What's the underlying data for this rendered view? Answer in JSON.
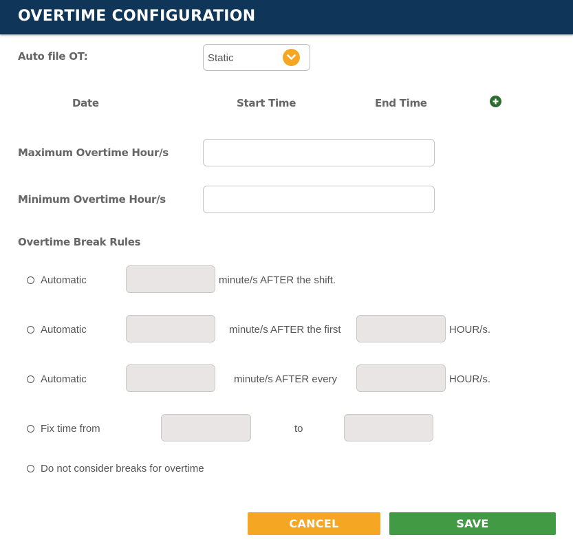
{
  "header": {
    "title": "OVERTIME CONFIGURATION"
  },
  "auto_file": {
    "label": "Auto file OT:",
    "selected": "Static"
  },
  "columns": {
    "date": "Date",
    "start": "Start Time",
    "end": "End Time"
  },
  "max_ot": {
    "label": "Maximum Overtime Hour/s",
    "value": ""
  },
  "min_ot": {
    "label": "Minimum Overtime Hour/s",
    "value": ""
  },
  "break_rules": {
    "title": "Overtime Break Rules",
    "r1": {
      "label": "Automatic",
      "suffix": "minute/s AFTER the shift."
    },
    "r2": {
      "label": "Automatic",
      "middle": "minute/s AFTER the first",
      "suffix": "HOUR/s."
    },
    "r3": {
      "label": "Automatic",
      "middle": "minute/s AFTER every",
      "suffix": "HOUR/s."
    },
    "r4": {
      "label": "Fix time from",
      "middle": "to"
    },
    "r5": {
      "label": "Do not consider breaks for overtime"
    }
  },
  "buttons": {
    "cancel": "CANCEL",
    "save": "SAVE"
  },
  "colors": {
    "header": "#0f3559",
    "accent_orange": "#f5a623",
    "save_green": "#439a45",
    "add_icon": "#2e6b2e"
  }
}
